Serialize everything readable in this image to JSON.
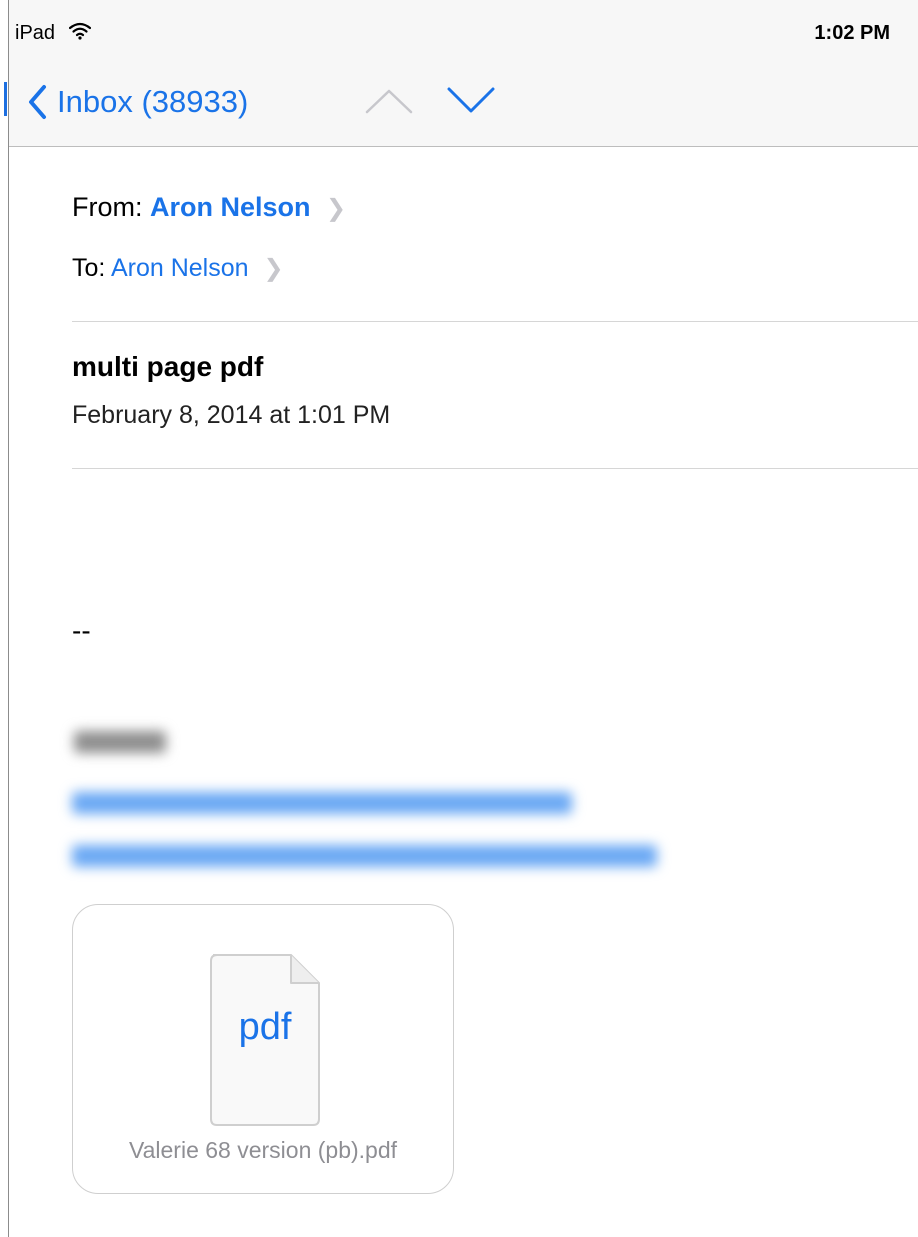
{
  "status_bar": {
    "carrier": "iPad",
    "time": "1:02 PM"
  },
  "nav": {
    "back_label": "Inbox (38933)"
  },
  "message": {
    "from_label": "From:",
    "from_name": "Aron Nelson",
    "to_label": "To:",
    "to_name": "Aron Nelson",
    "subject": "multi page pdf",
    "date": "February 8, 2014 at 1:01 PM",
    "signature_separator": "--"
  },
  "attachment": {
    "extension": "pdf",
    "filename": "Valerie 68 version (pb).pdf"
  },
  "colors": {
    "accent": "#1a73e8",
    "bar_background": "#f7f7f7"
  }
}
